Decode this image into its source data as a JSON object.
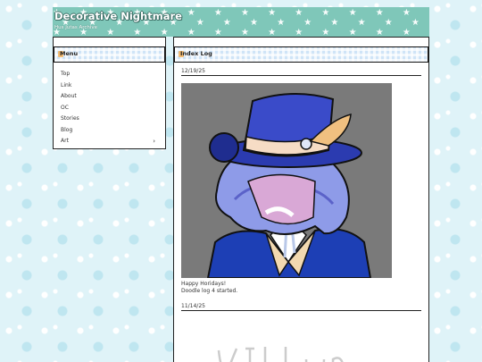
{
  "site": {
    "title": "Decorative Nightmare",
    "subtitle": "Hus Jutas Archive"
  },
  "menu": {
    "heading": "Menu",
    "items": [
      {
        "label": "Top"
      },
      {
        "label": "Link"
      },
      {
        "label": "About"
      },
      {
        "label": "OC"
      },
      {
        "label": "Stories"
      },
      {
        "label": "Blog"
      },
      {
        "label": "Art",
        "chevron": "›"
      }
    ]
  },
  "main": {
    "heading": "Index Log",
    "entries": [
      {
        "date": "12/19/25",
        "text_line1": "Happy Horidays!",
        "text_line2": "Doodle log 4 started."
      },
      {
        "date": "11/14/25"
      }
    ]
  },
  "colors": {
    "header_bg": "#7fc7b9",
    "bar_bg": "#cfe4f7",
    "art_bg": "#7a7a7a",
    "accent_dot": "#f4b35c"
  },
  "icons": {
    "art_chevron": "chevron-right-icon"
  }
}
